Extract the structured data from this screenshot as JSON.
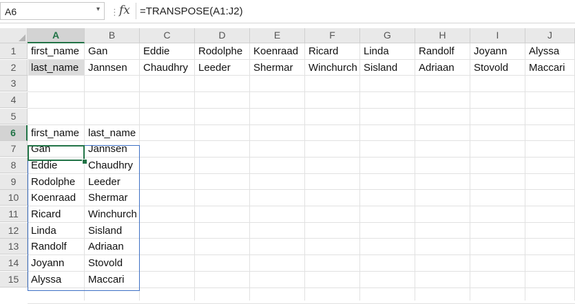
{
  "formula_bar": {
    "name_box": "A6",
    "fx_label": "fx",
    "formula": "=TRANSPOSE(A1:J2)"
  },
  "columns": [
    "A",
    "B",
    "C",
    "D",
    "E",
    "F",
    "G",
    "H",
    "I",
    "J"
  ],
  "rows": [
    "1",
    "2",
    "3",
    "4",
    "5",
    "6",
    "7",
    "8",
    "9",
    "10",
    "11",
    "12",
    "13",
    "14",
    "15"
  ],
  "source_row1": [
    "first_name",
    "Gan",
    "Eddie",
    "Rodolphe",
    "Koenraad",
    "Ricard",
    "Linda",
    "Randolf",
    "Joyann",
    "Alyssa"
  ],
  "source_row2": [
    "last_name",
    "Jannsen",
    "Chaudhry",
    "Leeder",
    "Shermar",
    "Winchurch",
    "Sisland",
    "Adriaan",
    "Stovold",
    "Maccari"
  ],
  "transposed": [
    [
      "first_name",
      "last_name"
    ],
    [
      "Gan",
      "Jannsen"
    ],
    [
      "Eddie",
      "Chaudhry"
    ],
    [
      "Rodolphe",
      "Leeder"
    ],
    [
      "Koenraad",
      "Shermar"
    ],
    [
      "Ricard",
      "Winchurch"
    ],
    [
      "Linda",
      "Sisland"
    ],
    [
      "Randolf",
      "Adriaan"
    ],
    [
      "Joyann",
      "Stovold"
    ],
    [
      "Alyssa",
      "Maccari"
    ]
  ],
  "colors": {
    "accent": "#217346",
    "spill_border": "#3c6fc4",
    "header_bg": "#e9e9e9"
  }
}
